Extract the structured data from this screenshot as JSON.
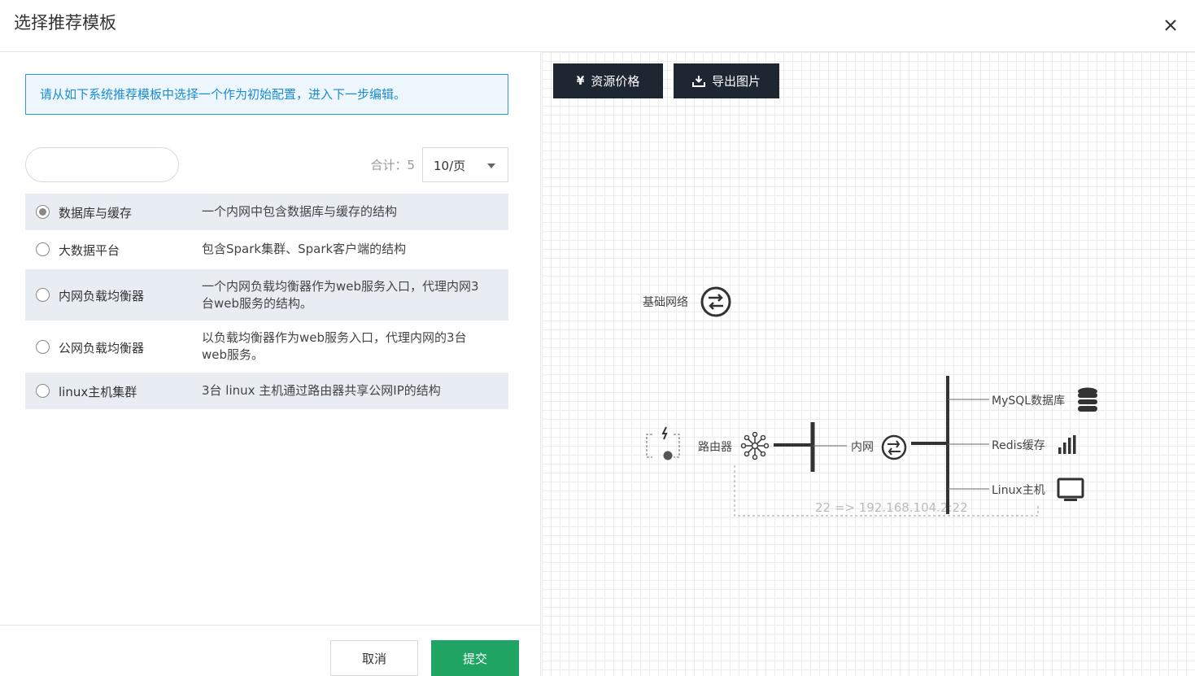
{
  "header": {
    "title": "选择推荐模板"
  },
  "notice": "请从如下系统推荐模板中选择一个作为初始配置，进入下一步编辑。",
  "search": {
    "value": ""
  },
  "pagination": {
    "total_label": "合计：5",
    "page_size": "10/页"
  },
  "templates": [
    {
      "name": "数据库与缓存",
      "desc": "一个内网中包含数据库与缓存的结构",
      "selected": true
    },
    {
      "name": "大数据平台",
      "desc": "包含Spark集群、Spark客户端的结构",
      "selected": false
    },
    {
      "name": "内网负载均衡器",
      "desc": "一个内网负载均衡器作为web服务入口，代理内网3台web服务的结构。",
      "selected": false
    },
    {
      "name": "公网负载均衡器",
      "desc": "以负载均衡器作为web服务入口，代理内网的3台web服务。",
      "selected": false
    },
    {
      "name": "linux主机集群",
      "desc": "3台 linux 主机通过路由器共享公网IP的结构",
      "selected": false
    }
  ],
  "footer": {
    "cancel_label": "取消",
    "submit_label": "提交"
  },
  "toolbar": {
    "price_icon": "¥",
    "price_label": "资源价格",
    "export_icon": "download-icon",
    "export_label": "导出图片"
  },
  "diagram": {
    "base_network": "基础网络",
    "router": "路由器",
    "intranet": "内网",
    "mysql": "MySQL数据库",
    "redis": "Redis缓存",
    "linux": "Linux主机",
    "port_forward": "22 => 192.168.104.2:22"
  }
}
